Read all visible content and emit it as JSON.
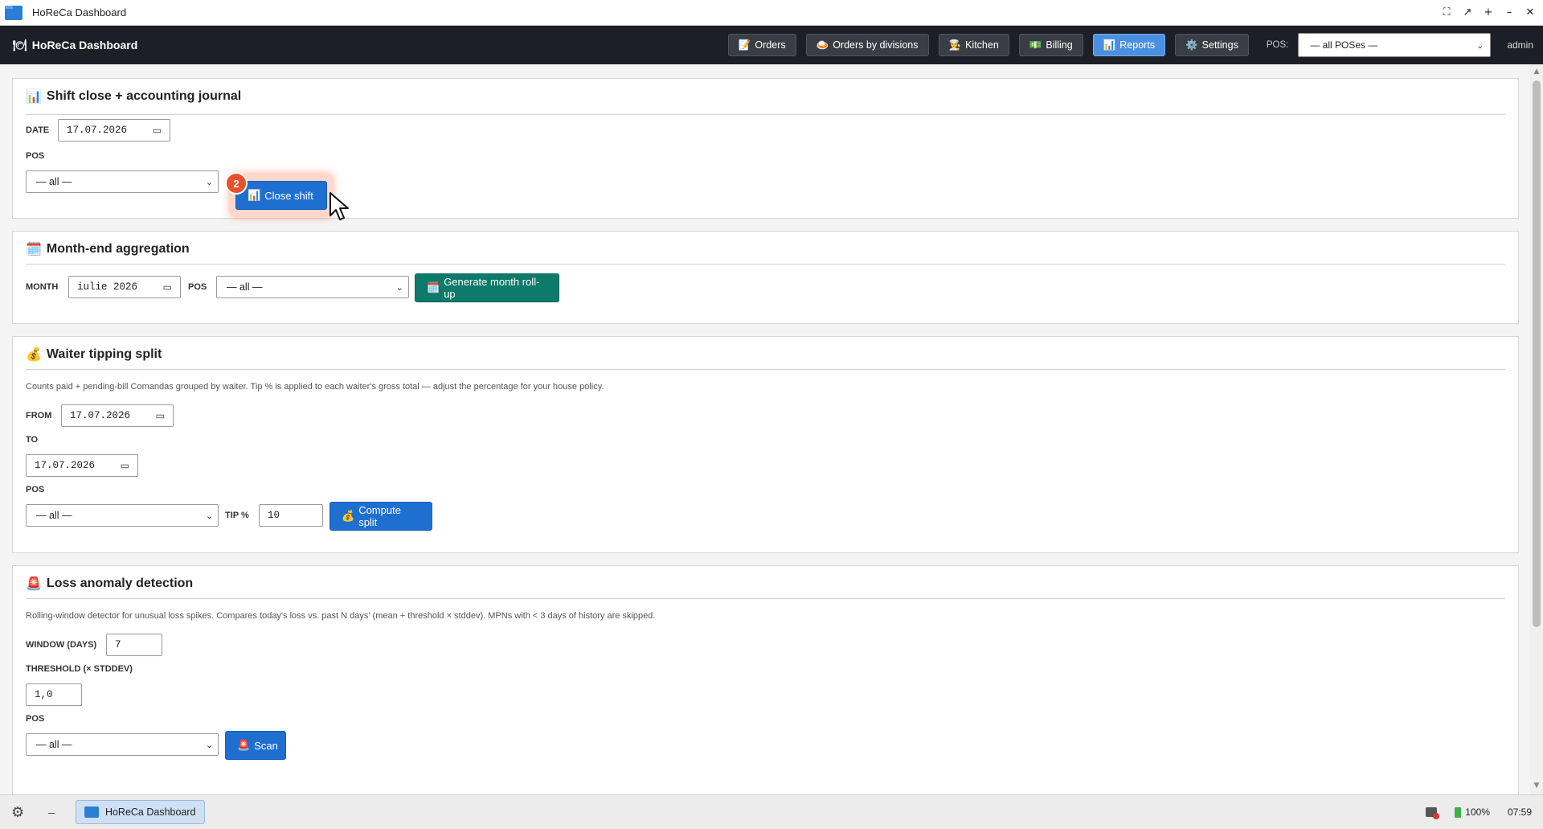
{
  "window": {
    "title": "HoReCa Dashboard",
    "controls": [
      "⛶",
      "↗",
      "+",
      "–",
      "✕"
    ]
  },
  "header": {
    "brand": "HoReCa Dashboard",
    "brand_icon": "🍽",
    "nav": [
      {
        "icon": "📝",
        "label": "Orders"
      },
      {
        "icon": "🍛",
        "label": "Orders by divisions"
      },
      {
        "icon": "👨‍🍳",
        "label": "Kitchen"
      },
      {
        "icon": "💵",
        "label": "Billing"
      },
      {
        "icon": "📊",
        "label": "Reports",
        "active": true
      },
      {
        "icon": "⚙️",
        "label": "Settings"
      }
    ],
    "pos_label": "POS:",
    "pos_value": "— all POSes —",
    "user": "admin"
  },
  "shift_close": {
    "icon": "📊",
    "title": "Shift close + accounting journal",
    "date_label": "DATE",
    "date_value": "17.07.2026",
    "pos_label": "POS",
    "pos_value": "— all —",
    "button_icon": "📊",
    "button_label": "Close shift",
    "step_badge": "2"
  },
  "month_end": {
    "icon": "🗓️",
    "title": "Month-end aggregation",
    "month_label": "MONTH",
    "month_value": "iulie 2026",
    "pos_label": "POS",
    "pos_value": "— all —",
    "button_icon": "🗓️",
    "button_label": "Generate month roll-up"
  },
  "tipping": {
    "icon": "💰",
    "title": "Waiter tipping split",
    "description": "Counts paid + pending-bill Comandas grouped by waiter. Tip % is applied to each waiter's gross total — adjust the percentage for your house policy.",
    "from_label": "FROM",
    "from_value": "17.07.2026",
    "to_label": "TO",
    "to_value": "17.07.2026",
    "pos_label": "POS",
    "pos_value": "— all —",
    "tip_label": "TIP %",
    "tip_value": "10",
    "button_icon": "💰",
    "button_label": "Compute split"
  },
  "loss": {
    "icon": "🚨",
    "title": "Loss anomaly detection",
    "description": "Rolling-window detector for unusual loss spikes. Compares today's loss vs. past N days' (mean + threshold × stddev). MPNs with < 3 days of history are skipped.",
    "window_label": "WINDOW (DAYS)",
    "window_value": "7",
    "threshold_label": "THRESHOLD (× STDDEV)",
    "threshold_value": "1,0",
    "pos_label": "POS",
    "pos_value": "— all —",
    "button_icon": "🚨",
    "button_label": "Scan"
  },
  "taskbar": {
    "task_label": "HoReCa Dashboard",
    "battery": "100%",
    "clock": "07:59"
  }
}
